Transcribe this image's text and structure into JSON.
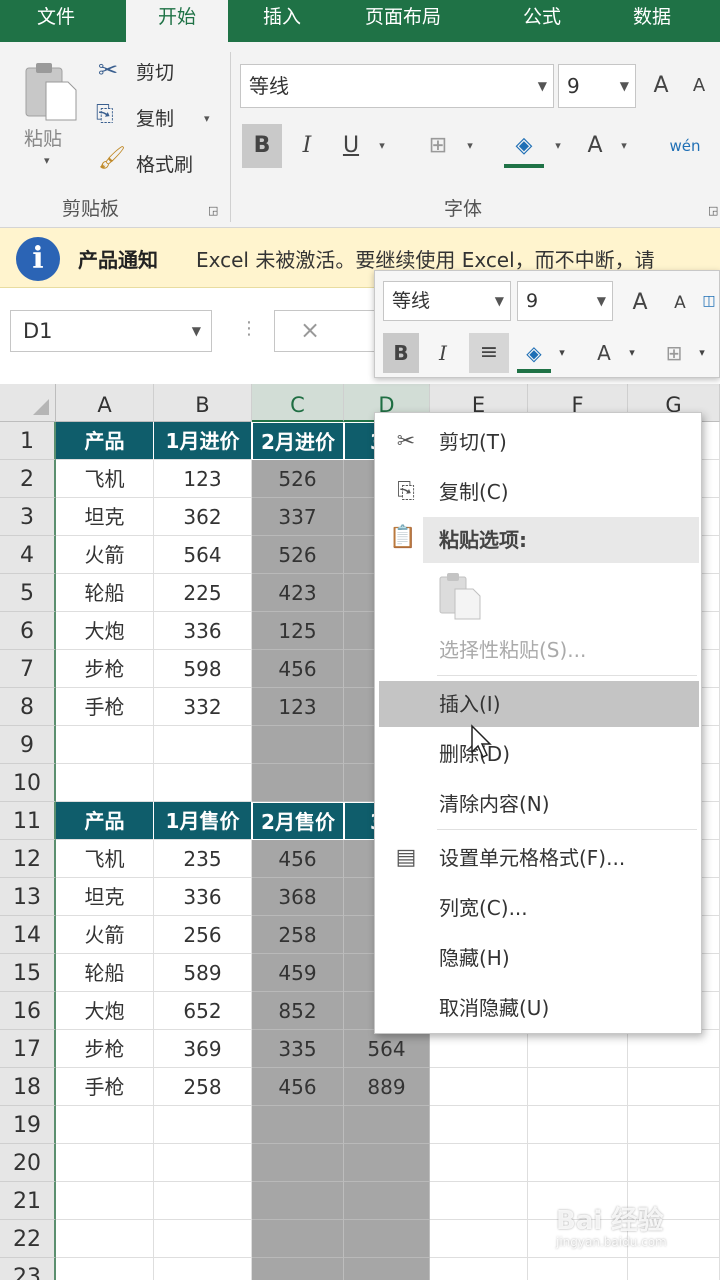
{
  "ribbon_tabs": [
    "文件",
    "开始",
    "插入",
    "页面布局",
    "公式",
    "数据"
  ],
  "active_tab": "开始",
  "clipboard": {
    "paste_label": "粘贴",
    "cut_label": "剪切",
    "copy_label": "复制",
    "format_painter_label": "格式刷",
    "group_label": "剪贴板"
  },
  "font_group": {
    "font_name": "等线",
    "font_size": "9",
    "group_label": "字体",
    "bold": "B",
    "italic": "I",
    "underline": "U",
    "grow_font": "A",
    "shrink_font": "A",
    "font_color": "A",
    "phonetic": "wén"
  },
  "notification": {
    "title": "产品通知",
    "message": "Excel 未被激活。要继续使用 Excel，而不中断，请"
  },
  "name_box": "D1",
  "formula_cancel": "×",
  "column_headers": [
    "A",
    "B",
    "C",
    "D",
    "E",
    "F",
    "G"
  ],
  "row_numbers": [
    "1",
    "2",
    "3",
    "4",
    "5",
    "6",
    "7",
    "8",
    "9",
    "10",
    "11",
    "12",
    "13",
    "14",
    "15",
    "16",
    "17",
    "18",
    "19",
    "20",
    "21",
    "22",
    "23"
  ],
  "table1": {
    "headers": [
      "产品",
      "1月进价",
      "2月进价",
      "3月"
    ],
    "rows": [
      [
        "飞机",
        "123",
        "526",
        ""
      ],
      [
        "坦克",
        "362",
        "337",
        ""
      ],
      [
        "火箭",
        "564",
        "526",
        ""
      ],
      [
        "轮船",
        "225",
        "423",
        ""
      ],
      [
        "大炮",
        "336",
        "125",
        ""
      ],
      [
        "步枪",
        "598",
        "456",
        ""
      ],
      [
        "手枪",
        "332",
        "123",
        ""
      ]
    ]
  },
  "table2": {
    "headers": [
      "产品",
      "1月售价",
      "2月售价",
      "3月"
    ],
    "rows": [
      [
        "飞机",
        "235",
        "456",
        ""
      ],
      [
        "坦克",
        "336",
        "368",
        ""
      ],
      [
        "火箭",
        "256",
        "258",
        ""
      ],
      [
        "轮船",
        "589",
        "459",
        ""
      ],
      [
        "大炮",
        "652",
        "852",
        ""
      ],
      [
        "步枪",
        "369",
        "335",
        "564"
      ],
      [
        "手枪",
        "258",
        "456",
        "889"
      ]
    ]
  },
  "mini_toolbar": {
    "font_name": "等线",
    "font_size": "9",
    "bold": "B",
    "italic": "I",
    "grow_font": "A",
    "shrink_font": "A",
    "font_color": "A"
  },
  "context_menu": {
    "cut": "剪切(T)",
    "copy": "复制(C)",
    "paste_options": "粘贴选项:",
    "paste_special": "选择性粘贴(S)...",
    "insert": "插入(I)",
    "delete": "删除(D)",
    "clear_contents": "清除内容(N)",
    "format_cells": "设置单元格格式(F)...",
    "column_width": "列宽(C)...",
    "hide": "隐藏(H)",
    "unhide": "取消隐藏(U)"
  },
  "watermark": {
    "brand": "Bai 经验",
    "url": "jingyan.baidu.com"
  },
  "colors": {
    "excel_green": "#1f7246",
    "table_header_teal": "#0f5d6b",
    "selected_column": "#a6a6a6",
    "menu_hover": "#c4c4c4",
    "notify_bg": "#fff4ce"
  }
}
